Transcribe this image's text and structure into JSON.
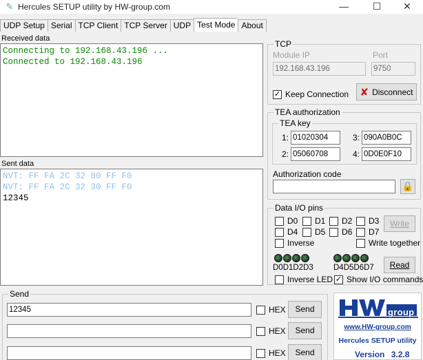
{
  "window": {
    "title": "Hercules SETUP utility by HW-group.com",
    "minimize": "—",
    "maximize": "☐",
    "close": "✕"
  },
  "tabs": [
    "UDP Setup",
    "Serial",
    "TCP Client",
    "TCP Server",
    "UDP",
    "Test Mode",
    "About"
  ],
  "active_tab": "Test Mode",
  "received": {
    "label": "Received data",
    "lines": [
      "Connecting to 192.168.43.196 ...",
      "Connected to 192.168.43.196"
    ]
  },
  "sent": {
    "label": "Sent data",
    "lines": [
      "NVT: FF FA 2C 32 00 FF F0",
      "NVT: FF FA 2C 32 30 FF F0",
      "12345"
    ]
  },
  "tcp": {
    "title": "TCP",
    "module_ip_label": "Module IP",
    "module_ip": "192.168.43.196",
    "port_label": "Port",
    "port": "9750",
    "keep_connection_label": "Keep Connection",
    "keep_connection": true,
    "disconnect_label": "Disconnect"
  },
  "tea": {
    "title": "TEA authorization",
    "key_title": "TEA key",
    "keys": [
      {
        "n": "1:",
        "v": "01020304"
      },
      {
        "n": "3:",
        "v": "090A0B0C"
      },
      {
        "n": "2:",
        "v": "05060708"
      },
      {
        "n": "4:",
        "v": "0D0E0F10"
      }
    ],
    "auth_code_label": "Authorization code",
    "auth_code": ""
  },
  "io": {
    "title": "Data I/O pins",
    "pins_row1": [
      "D0",
      "D1",
      "D2",
      "D3"
    ],
    "pins_row2": [
      "D4",
      "D5",
      "D6",
      "D7"
    ],
    "write_label": "Write",
    "inverse_label": "Inverse",
    "write_together_label": "Write together",
    "leds_left_label": "D0D1D2D3",
    "leds_right_label": "D4D5D6D7",
    "read_label": "Read",
    "inverse_led_label": "Inverse LED",
    "inverse_led": false,
    "show_io_label": "Show I/O commands",
    "show_io": true
  },
  "send": {
    "title": "Send",
    "rows": [
      {
        "value": "12345",
        "hex_label": "HEX",
        "hex": false,
        "button": "Send"
      },
      {
        "value": "",
        "hex_label": "HEX",
        "hex": false,
        "button": "Send"
      },
      {
        "value": "",
        "hex_label": "HEX",
        "hex": false,
        "button": "Send"
      }
    ]
  },
  "logo": {
    "hw": "HW",
    "group": "group",
    "url": "www.HW-group.com",
    "product": "Hercules SETUP utility",
    "version_label": "Version",
    "version": "3.2.8"
  },
  "colors": {
    "received_text": "#0a8a00",
    "nvt_text": "#8fc2e8",
    "logo_blue": "#1a3f99",
    "disconnect_x": "#c81a1a"
  }
}
